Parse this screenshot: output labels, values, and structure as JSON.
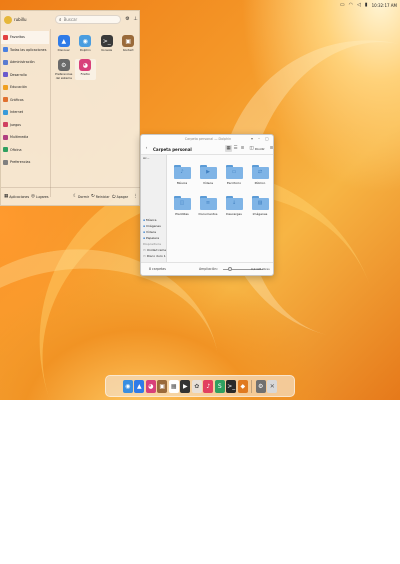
{
  "topbar": {
    "clock": "10:32:17 AM",
    "icons": [
      "screen-icon",
      "wifi-icon",
      "volume-icon",
      "battery-icon"
    ]
  },
  "launcher": {
    "username": "rubillu",
    "search": {
      "value": "",
      "placeholder": "Buscar"
    },
    "categories": [
      {
        "label": "Favoritos",
        "color": "#e24040"
      },
      {
        "label": "Todas las aplicaciones",
        "color": "#4a80e0"
      },
      {
        "label": "Administración",
        "color": "#5a7bd0"
      },
      {
        "label": "Desarrollo",
        "color": "#6a5acd"
      },
      {
        "label": "Educación",
        "color": "#f0a020"
      },
      {
        "label": "Gráficos",
        "color": "#e07030"
      },
      {
        "label": "Internet",
        "color": "#3a9ad9"
      },
      {
        "label": "Juegos",
        "color": "#d04060"
      },
      {
        "label": "Multimedia",
        "color": "#b04080"
      },
      {
        "label": "Oficina",
        "color": "#30a060"
      },
      {
        "label": "Preferencias",
        "color": "#808080"
      }
    ],
    "apps": [
      {
        "name": "Discover",
        "icon": "discover-icon",
        "color": "#2f7be8",
        "glyph": "▲"
      },
      {
        "name": "Dolphin",
        "icon": "dolphin-icon",
        "color": "#4a9de0",
        "glyph": "◉"
      },
      {
        "name": "Konsole",
        "icon": "konsole-icon",
        "color": "#3a3a3a",
        "glyph": ">_"
      },
      {
        "name": "Kontact",
        "icon": "kontact-icon",
        "color": "#9a6a3a",
        "glyph": "▣"
      },
      {
        "name": "Preferencias del sistema",
        "icon": "settings-icon",
        "color": "#6a6a6a",
        "glyph": "⚙"
      },
      {
        "name": "Firefox",
        "icon": "firefox-icon",
        "color": "#d8407a",
        "glyph": "◕"
      }
    ],
    "footer": {
      "apps": "Aplicaciones",
      "places": "Lugares",
      "sleep": "Dormir",
      "restart": "Reiniciar",
      "shutdown": "Apagar"
    }
  },
  "filemanager": {
    "title": "Carpeta personal — Dolphin",
    "location": "Carpeta personal",
    "split_label": "Dividir",
    "sidebar": {
      "top_partial": "Ac...",
      "items": [
        "Música",
        "Imágenes",
        "Vídeos",
        "Papelera"
      ],
      "devices_header": "Dispositivos",
      "devices": [
        "Unidad reme...",
        "Disco duro 1..."
      ]
    },
    "folders": [
      {
        "name": "Música",
        "glyph": "♪"
      },
      {
        "name": "Vídeos",
        "glyph": "▶"
      },
      {
        "name": "Escritorio",
        "glyph": "▭"
      },
      {
        "name": "Público",
        "glyph": "⇄"
      },
      {
        "name": "Plantillas",
        "glyph": "◫"
      },
      {
        "name": "Documentos",
        "glyph": "≡"
      },
      {
        "name": "Descargas",
        "glyph": "↓"
      },
      {
        "name": "Imágenes",
        "glyph": "▨"
      }
    ],
    "status": {
      "count": "8 carpetas",
      "zoom_label": "Ampliación:",
      "zoom_fraction": 0.15,
      "free": "0,9 GiB libres"
    }
  },
  "dock": {
    "items": [
      {
        "name": "dolphin",
        "color": "#3a8ee0",
        "glyph": "◉"
      },
      {
        "name": "discover",
        "color": "#2f7be8",
        "glyph": "▲"
      },
      {
        "name": "firefox",
        "color": "#d8407a",
        "glyph": "◕"
      },
      {
        "name": "kontact",
        "color": "#9a6a3a",
        "glyph": "▣"
      },
      {
        "name": "calendar",
        "color": "#ffffff",
        "glyph": "▦"
      },
      {
        "name": "video",
        "color": "#333333",
        "glyph": "▶"
      },
      {
        "name": "photos",
        "color": "#e8e0d8",
        "glyph": "✿"
      },
      {
        "name": "music",
        "color": "#e24060",
        "glyph": "♪"
      },
      {
        "name": "office",
        "color": "#2fa060",
        "glyph": "S"
      },
      {
        "name": "konsole",
        "color": "#2a2a2a",
        "glyph": ">_"
      },
      {
        "name": "software",
        "color": "#e07a20",
        "glyph": "◆"
      },
      {
        "name": "settings",
        "color": "#707070",
        "glyph": "⚙"
      },
      {
        "name": "trash",
        "color": "#d8d8d8",
        "glyph": "✕"
      }
    ]
  }
}
